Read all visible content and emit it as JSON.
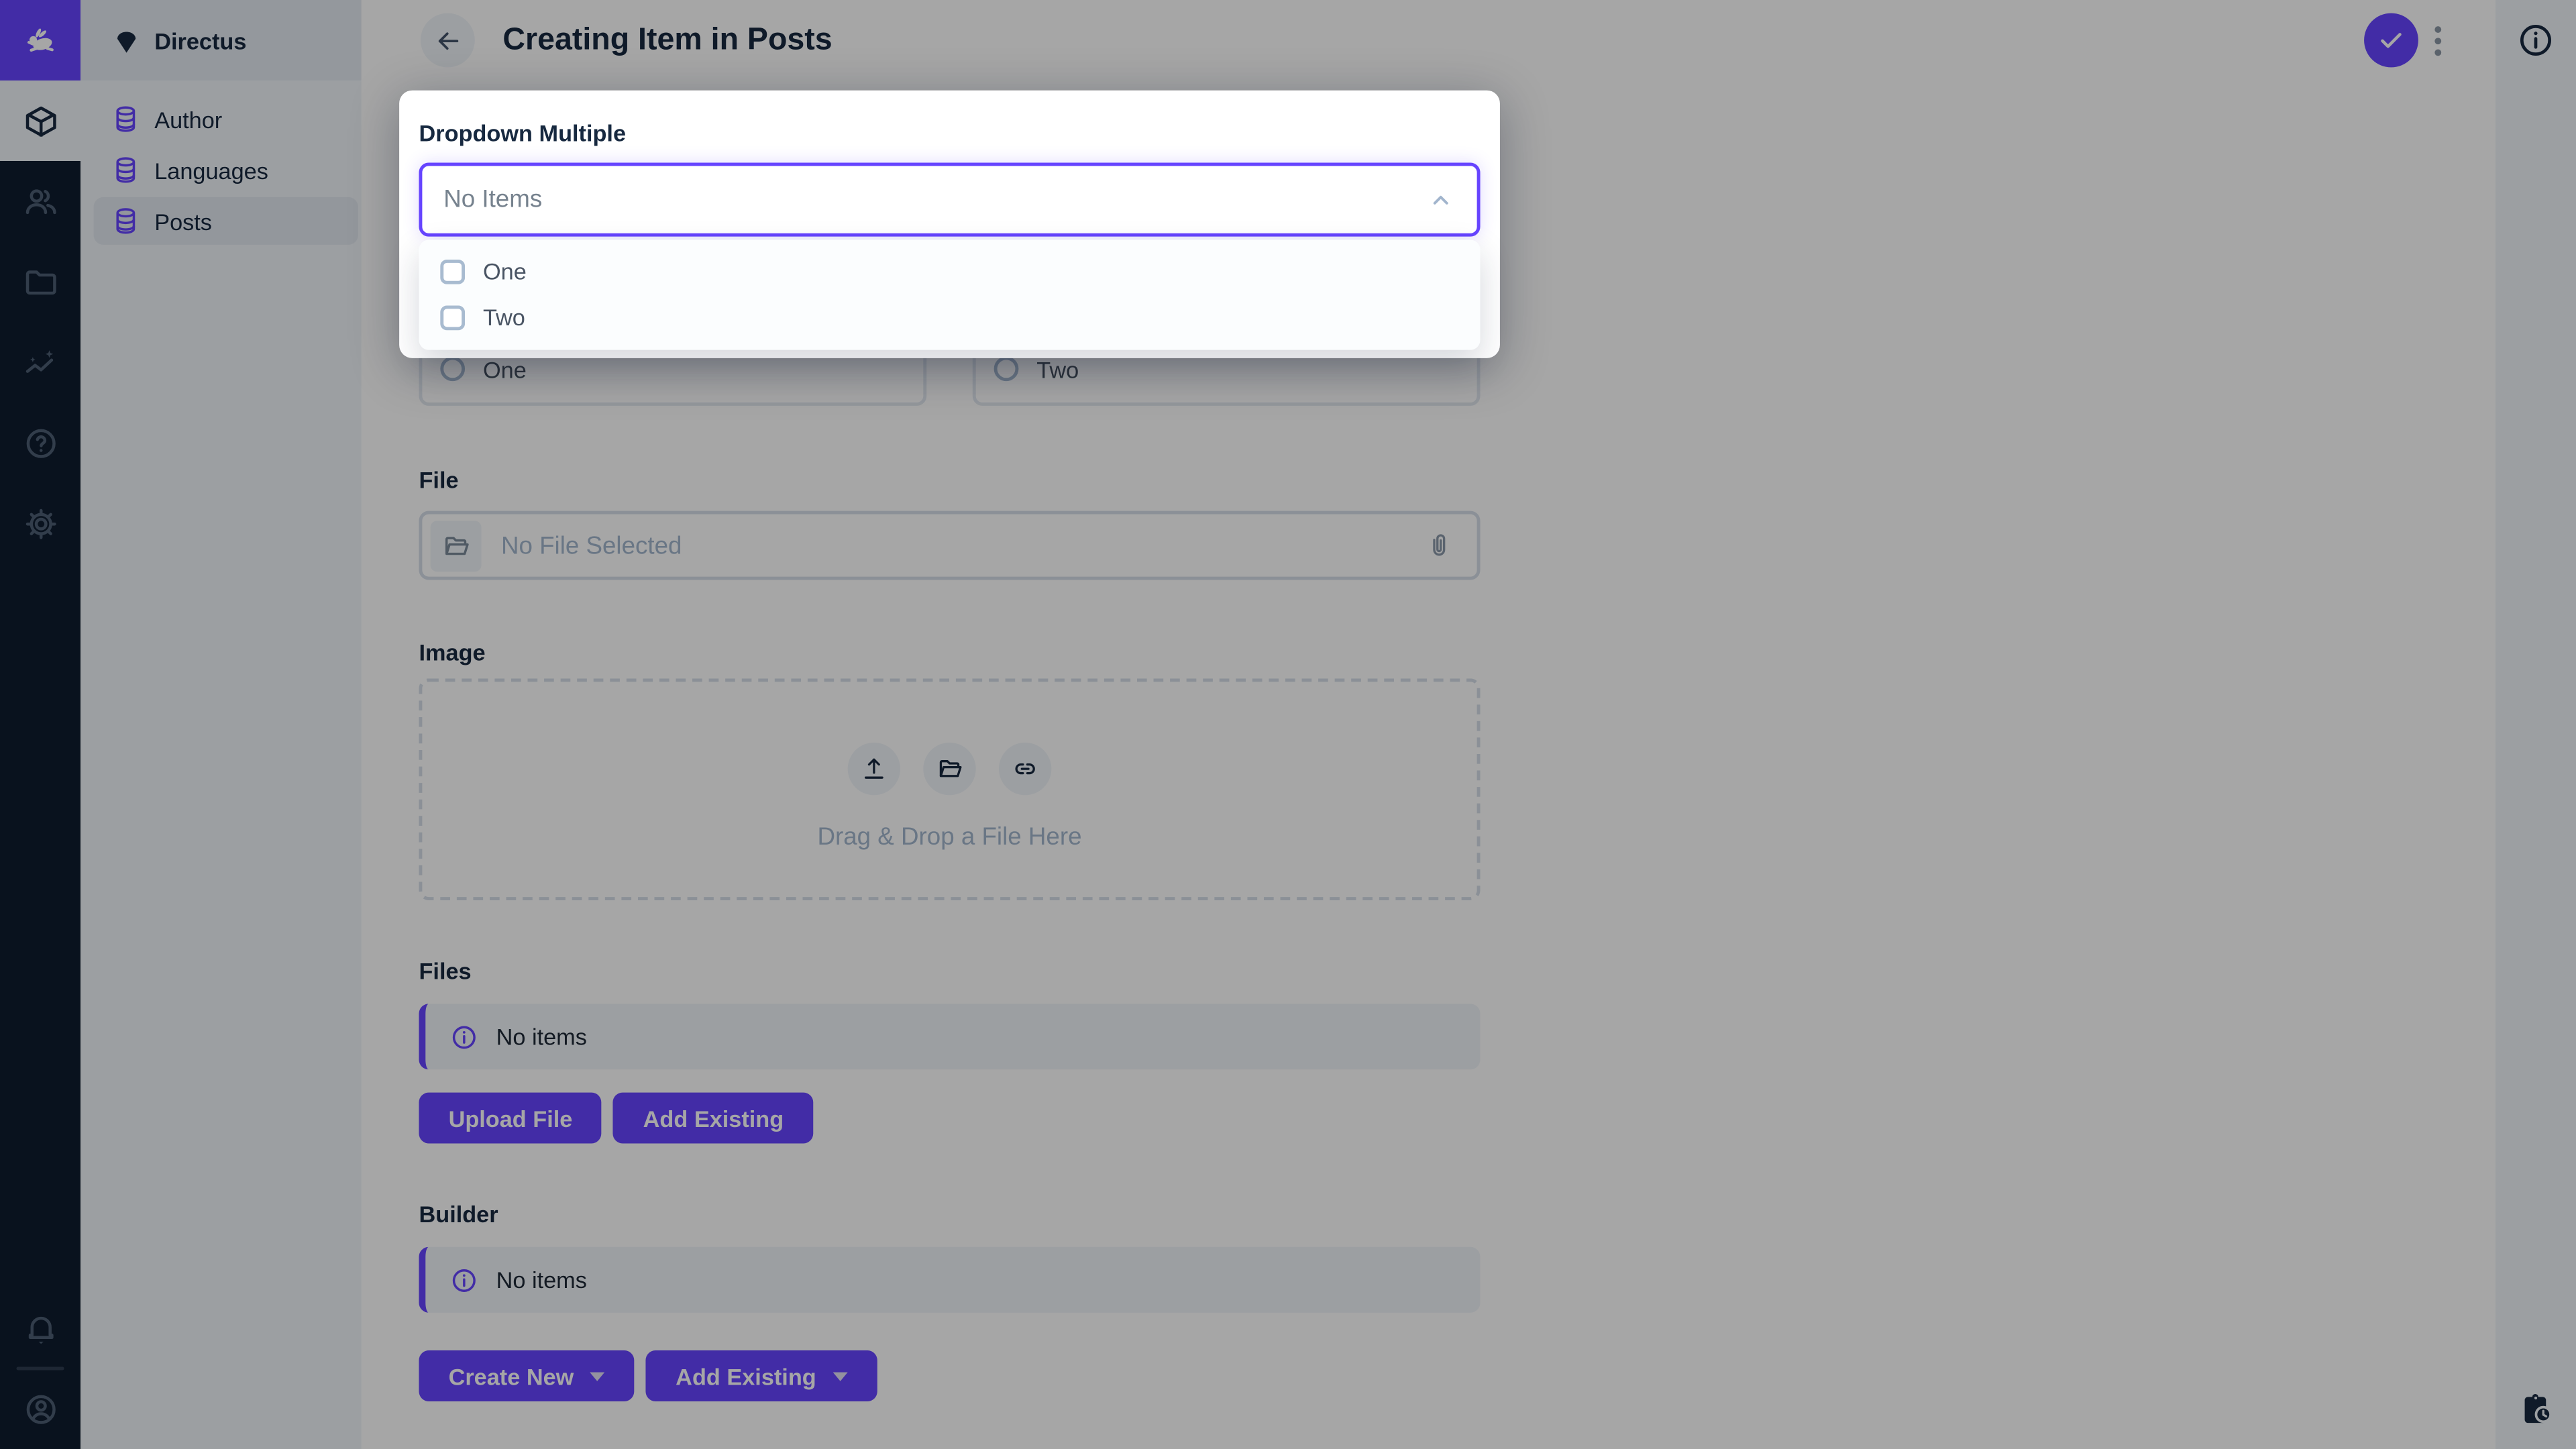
{
  "module_bar": {
    "icons": [
      "directus-logo",
      "content-module",
      "users-module",
      "files-module",
      "insights-module",
      "help-module",
      "settings-module",
      "notifications-bell",
      "account-avatar"
    ]
  },
  "sidebar": {
    "project_name": "Directus",
    "items": [
      {
        "label": "Author",
        "active": false
      },
      {
        "label": "Languages",
        "active": false
      },
      {
        "label": "Posts",
        "active": true
      }
    ]
  },
  "header": {
    "title": "Creating Item in Posts",
    "actions": [
      "back",
      "save",
      "more-options",
      "info"
    ]
  },
  "modal": {
    "label": "Dropdown Multiple",
    "value": "No Items",
    "options": [
      {
        "label": "One",
        "checked": false
      },
      {
        "label": "Two",
        "checked": false
      }
    ]
  },
  "radios": [
    {
      "label": "One",
      "selected": false
    },
    {
      "label": "Two",
      "selected": false
    }
  ],
  "file": {
    "label": "File",
    "placeholder": "No File Selected"
  },
  "image": {
    "label": "Image",
    "dropzone_text": "Drag & Drop a File Here"
  },
  "files": {
    "label": "Files",
    "notice": "No items",
    "upload_button": "Upload File",
    "add_button": "Add Existing"
  },
  "builder": {
    "label": "Builder",
    "notice": "No items",
    "create_button": "Create New",
    "add_button": "Add Existing"
  },
  "colors": {
    "accent": "#6644FF",
    "module_bar_bg": "#0E1C2F",
    "nav_bg": "#F0F4F9",
    "nav_header_bg": "#E4EAF1",
    "text_dark": "#172940",
    "placeholder": "#A2B5CD",
    "overlay": "rgba(0,0,0,0.35)"
  }
}
